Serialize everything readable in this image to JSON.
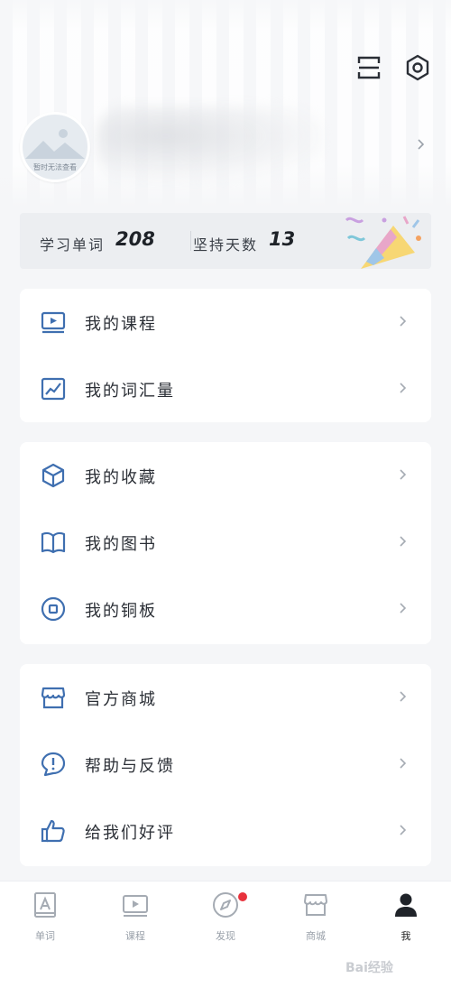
{
  "header": {
    "avatar_placeholder": "暂时无法查看"
  },
  "stats": {
    "words_label": "学习单词",
    "words_value": "208",
    "days_label": "坚持天数",
    "days_value": "13"
  },
  "menu": {
    "group1": [
      {
        "label": "我的课程",
        "icon": "video-icon"
      },
      {
        "label": "我的词汇量",
        "icon": "chart-icon"
      }
    ],
    "group2": [
      {
        "label": "我的收藏",
        "icon": "cube-icon"
      },
      {
        "label": "我的图书",
        "icon": "book-icon"
      },
      {
        "label": "我的铜板",
        "icon": "coin-icon"
      }
    ],
    "group3": [
      {
        "label": "官方商城",
        "icon": "store-icon"
      },
      {
        "label": "帮助与反馈",
        "icon": "help-icon"
      },
      {
        "label": "给我们好评",
        "icon": "thumbs-up-icon"
      }
    ]
  },
  "tabs": [
    {
      "label": "单词",
      "icon": "word-icon",
      "active": false
    },
    {
      "label": "课程",
      "icon": "video-icon",
      "active": false
    },
    {
      "label": "发现",
      "icon": "compass-icon",
      "active": false
    },
    {
      "label": "商城",
      "icon": "store-icon",
      "active": false
    },
    {
      "label": "我",
      "icon": "person-icon",
      "active": true
    }
  ],
  "watermark": "Bai经验",
  "colors": {
    "accent": "#3f6fb0",
    "badge": "#e8323c",
    "background": "#f5f6f8"
  }
}
